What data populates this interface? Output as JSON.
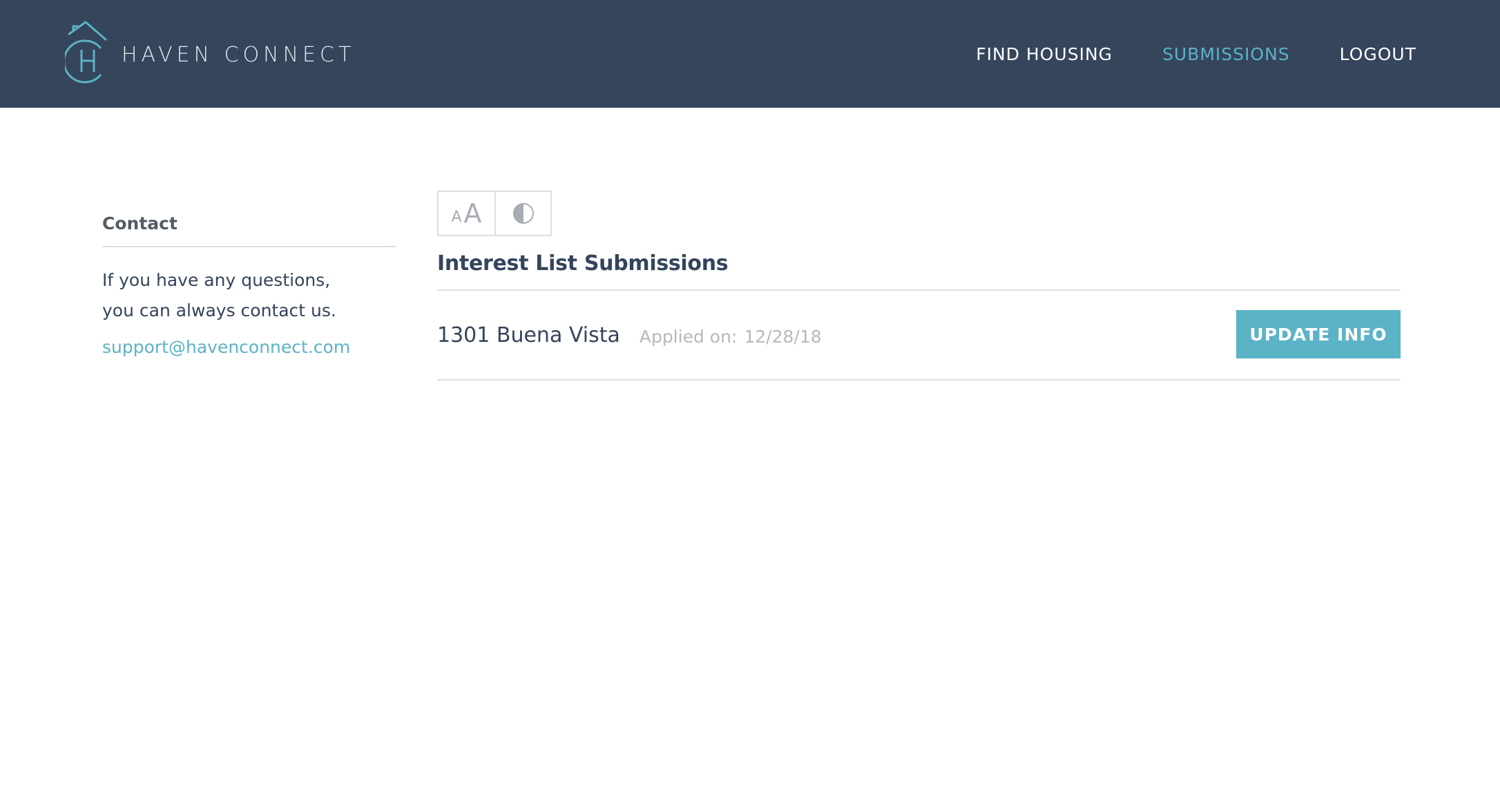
{
  "brand": {
    "name": "HAVEN CONNECT",
    "logo_icon": "house-h-logo-icon",
    "accent_color": "#5bb3c6",
    "header_color": "#35455c"
  },
  "nav": {
    "items": [
      {
        "label": "FIND HOUSING",
        "active": false
      },
      {
        "label": "SUBMISSIONS",
        "active": true
      },
      {
        "label": "LOGOUT",
        "active": false
      }
    ]
  },
  "sidebar": {
    "title": "Contact",
    "text_line1": "If you have any questions,",
    "text_line2": "you can always contact us.",
    "email": "support@havenconnect.com"
  },
  "accessibility": {
    "font_size_icon": "font-size-icon",
    "font_small": "A",
    "font_big": "A",
    "contrast_icon": "contrast-icon"
  },
  "main": {
    "title": "Interest List Submissions",
    "submissions": [
      {
        "property": "1301 Buena Vista",
        "applied_label": "Applied on:",
        "applied_date": "12/28/18",
        "action_label": "UPDATE INFO"
      }
    ]
  }
}
